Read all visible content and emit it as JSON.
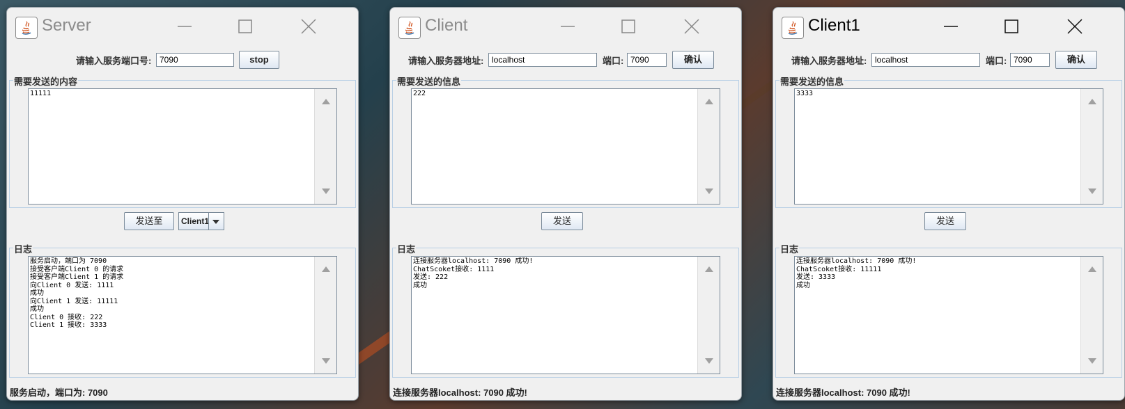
{
  "windows": {
    "server": {
      "title": "Server",
      "port_label": "请输入服务端口号:",
      "port_value": "7090",
      "stop_button": "stop",
      "send_group_title": "需要发送的内容",
      "send_text": "11111",
      "send_to_button": "发送至",
      "send_to_selected": "Client1",
      "log_group_title": "日志",
      "log_text": "服务启动，端口为 7090\n接受客户端Client 0 的请求\n接受客户端Client 1 的请求\n向Client 0 发送: 1111\n成功\n向Client 1 发送: 11111\n成功\nClient 0 接收: 222\nClient 1 接收: 3333",
      "status": "服务启动，端口为: 7090"
    },
    "client": {
      "title": "Client",
      "address_label": "请输入服务器地址:",
      "address_value": "localhost",
      "port_label": "端口:",
      "port_value": "7090",
      "confirm_button": "确认",
      "send_group_title": "需要发送的信息",
      "send_text": "222",
      "send_button": "发送",
      "log_group_title": "日志",
      "log_text": "连接服务器localhost: 7090 成功!\nChatScoket接收: 1111\n发送: 222\n成功",
      "status": "连接服务器localhost: 7090 成功!"
    },
    "client1": {
      "title": "Client1",
      "address_label": "请输入服务器地址:",
      "address_value": "localhost",
      "port_label": "端口:",
      "port_value": "7090",
      "confirm_button": "确认",
      "send_group_title": "需要发送的信息",
      "send_text": "3333",
      "send_button": "发送",
      "log_group_title": "日志",
      "log_text": "连接服务器localhost: 7090 成功!\nChatScoket接收: 11111\n发送: 3333\n成功",
      "status": "连接服务器localhost: 7090 成功!"
    }
  },
  "icons": {
    "app": "java-icon",
    "minimize": "minimize-icon",
    "maximize": "maximize-icon",
    "close": "close-icon"
  }
}
